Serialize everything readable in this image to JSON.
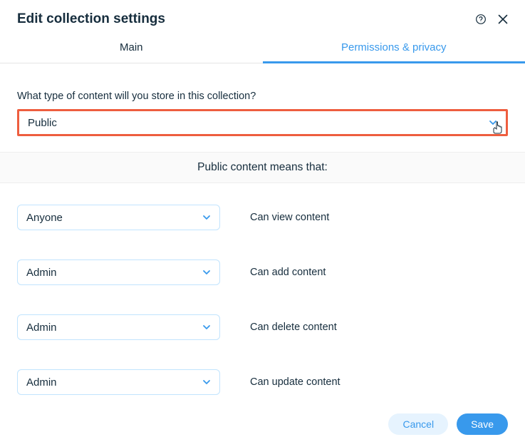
{
  "header": {
    "title": "Edit collection settings"
  },
  "tabs": {
    "main": "Main",
    "permissions": "Permissions & privacy"
  },
  "question": {
    "label": "What type of content will you store in this collection?",
    "value": "Public"
  },
  "banner": {
    "text": "Public content means that:"
  },
  "permissions": [
    {
      "value": "Anyone",
      "label": "Can view content"
    },
    {
      "value": "Admin",
      "label": "Can add content"
    },
    {
      "value": "Admin",
      "label": "Can delete content"
    },
    {
      "value": "Admin",
      "label": "Can update content"
    }
  ],
  "footer": {
    "cancel": "Cancel",
    "save": "Save"
  }
}
